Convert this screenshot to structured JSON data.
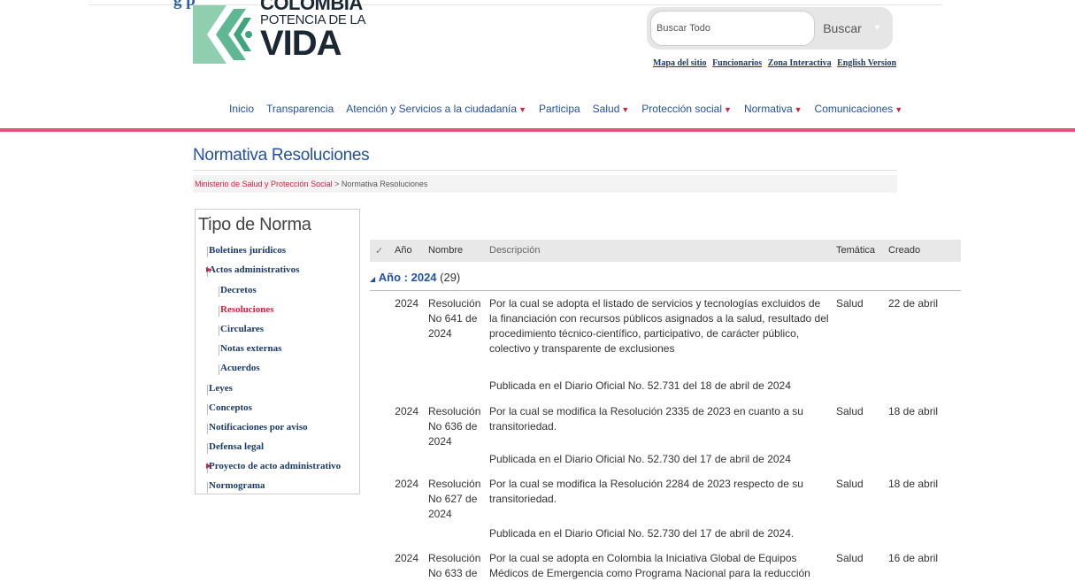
{
  "header": {
    "top_fragment": "g p",
    "logo": {
      "line1": "COLOMBIA",
      "line2": "POTENCIA DE LA",
      "line3": "VIDA"
    },
    "search": {
      "placeholder": "Buscar Todo",
      "button": "Buscar"
    },
    "toplinks": [
      "Mapa del sitio",
      "Funcionarios",
      "Zona Interactiva",
      "English Version"
    ]
  },
  "nav": [
    {
      "label": "Inicio",
      "dropdown": false
    },
    {
      "label": "Transparencia",
      "dropdown": false
    },
    {
      "label": "Atención y Servicios a la ciudadanía",
      "dropdown": true
    },
    {
      "label": "Participa",
      "dropdown": false
    },
    {
      "label": "Salud",
      "dropdown": true
    },
    {
      "label": "Protección social",
      "dropdown": true
    },
    {
      "label": "Normativa",
      "dropdown": true
    },
    {
      "label": "Comunicaciones",
      "dropdown": true
    }
  ],
  "page": {
    "title": "Normativa Resoluciones",
    "breadcrumb": {
      "link": "Ministerio de Salud y Protección Social",
      "sep": " > ",
      "current": "Normativa Resoluciones"
    }
  },
  "sidebar": {
    "title": "Tipo de Norma",
    "items": [
      {
        "label": "Boletines jurídicos",
        "level": 0,
        "active": false,
        "expand": false
      },
      {
        "label": "Actos administrativos",
        "level": 0,
        "active": false,
        "expand": true
      },
      {
        "label": "Decretos",
        "level": 1,
        "active": false,
        "expand": false
      },
      {
        "label": "Resoluciones",
        "level": 1,
        "active": true,
        "expand": false
      },
      {
        "label": "Circulares",
        "level": 1,
        "active": false,
        "expand": false
      },
      {
        "label": "Notas externas",
        "level": 1,
        "active": false,
        "expand": false
      },
      {
        "label": "Acuerdos",
        "level": 1,
        "active": false,
        "expand": false
      },
      {
        "label": "Leyes",
        "level": 0,
        "active": false,
        "expand": false
      },
      {
        "label": "Conceptos",
        "level": 0,
        "active": false,
        "expand": false
      },
      {
        "label": "Notificaciones por aviso",
        "level": 0,
        "active": false,
        "expand": false
      },
      {
        "label": "Defensa legal",
        "level": 0,
        "active": false,
        "expand": false
      },
      {
        "label": "Proyecto de acto administrativo",
        "level": 0,
        "active": false,
        "expand": true
      },
      {
        "label": "Normograma",
        "level": 0,
        "active": false,
        "expand": false
      }
    ]
  },
  "table": {
    "headers": {
      "check": "✓",
      "year": "Año",
      "name": "Nombre",
      "desc": "Descripción",
      "theme": "Temática",
      "created": "Creado"
    },
    "group": {
      "label": "Año : ",
      "value": "2024",
      "count": " (29)"
    },
    "rows": [
      {
        "year": "2024",
        "name": "Resolución No 641 de 2024",
        "desc": "Por la cual se adopta el listado de servicios y tecnologías excluidos de la financiación con recursos públicos asignados a la salud, resultado del procedimiento técnico-científico, participativo, de carácter público, colectivo y transparente de exclusiones",
        "pub": "Publicada en el Diario Oficial No. 52.731 del 18 de abril de 2024",
        "theme": "Salud",
        "created": "22 de abril"
      },
      {
        "year": "2024",
        "name": "Resolución No 636 de 2024",
        "desc": "Por la cual se modifica la Resolución 2335 de 2023 en cuanto a su transitoriedad.",
        "pub": "Publicada en el Diario Oficial No. 52.730 del 17  de abril de 2024",
        "theme": "Salud",
        "created": "18 de abril"
      },
      {
        "year": "2024",
        "name": "Resolución No 627 de 2024",
        "desc": "Por la cual se modifica la Resolución 2284 de 2023 respecto de su transitoriedad.",
        "pub": "Publicada en el Diario Oficial No. 52.730 del 17  de abril de 2024.",
        "theme": "Salud",
        "created": "18 de abril"
      },
      {
        "year": "2024",
        "name": "Resolución No 633 de",
        "desc": "Por la cual se adopta en Colombia la Iniciativa Global de Equipos Médicos de Emergencia como Programa Nacional para la reducción",
        "pub": "",
        "theme": "Salud",
        "created": "16 de abril"
      }
    ]
  }
}
